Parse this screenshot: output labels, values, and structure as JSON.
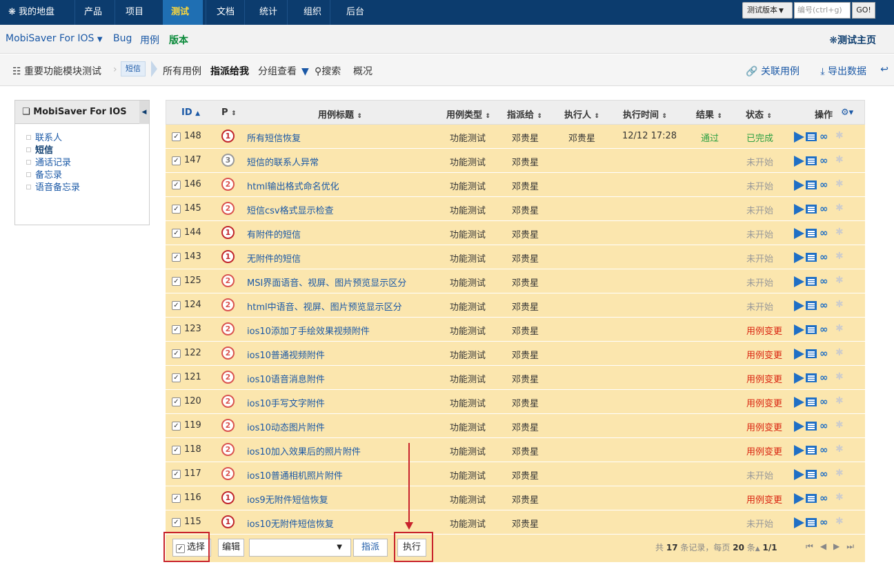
{
  "topnav": {
    "items": [
      "我的地盘",
      "产品",
      "项目",
      "测试",
      "文档",
      "统计",
      "组织",
      "后台"
    ],
    "home_icon": "home-icon",
    "version_button": "测试版本",
    "id_input_placeholder": "编号(ctrl+g)",
    "go_button": "GO!"
  },
  "subnav": {
    "product": "MobiSaver For IOS",
    "bug": "Bug",
    "case": "用例",
    "version": "版本",
    "home": "测试主页"
  },
  "featurebar": {
    "breadcrumb": "重要功能模块测试",
    "current_module": "短信",
    "tabs": [
      "所有用例",
      "指派给我",
      "分组查看",
      "搜索",
      "概况"
    ],
    "link_cases": "关联用例",
    "export_data": "导出数据"
  },
  "sidebar": {
    "title": "MobiSaver For IOS",
    "items": [
      "联系人",
      "短信",
      "通话记录",
      "备忘录",
      "语音备忘录"
    ],
    "active": "短信"
  },
  "table": {
    "headers": [
      "ID",
      "P",
      "用例标题",
      "用例类型",
      "指派给",
      "执行人",
      "执行时间",
      "结果",
      "状态",
      "操作"
    ],
    "rows": [
      {
        "id": "148",
        "p": "1",
        "title": "所有短信恢复",
        "type": "功能测试",
        "assign": "邓贵星",
        "executor": "邓贵星",
        "time": "12/12 17:28",
        "result": "通过",
        "status": "已完成",
        "status_color": "green"
      },
      {
        "id": "147",
        "p": "3",
        "title": "短信的联系人异常",
        "type": "功能测试",
        "assign": "邓贵星",
        "executor": "",
        "time": "",
        "result": "",
        "status": "未开始",
        "status_color": "gray"
      },
      {
        "id": "146",
        "p": "2",
        "title": "html输出格式命名优化",
        "type": "功能测试",
        "assign": "邓贵星",
        "executor": "",
        "time": "",
        "result": "",
        "status": "未开始",
        "status_color": "gray"
      },
      {
        "id": "145",
        "p": "2",
        "title": "短信csv格式显示检查",
        "type": "功能测试",
        "assign": "邓贵星",
        "executor": "",
        "time": "",
        "result": "",
        "status": "未开始",
        "status_color": "gray"
      },
      {
        "id": "144",
        "p": "1",
        "title": "有附件的短信",
        "type": "功能测试",
        "assign": "邓贵星",
        "executor": "",
        "time": "",
        "result": "",
        "status": "未开始",
        "status_color": "gray"
      },
      {
        "id": "143",
        "p": "1",
        "title": "无附件的短信",
        "type": "功能测试",
        "assign": "邓贵星",
        "executor": "",
        "time": "",
        "result": "",
        "status": "未开始",
        "status_color": "gray"
      },
      {
        "id": "125",
        "p": "2",
        "title": "MSI界面语音、视屏、图片预览显示区分",
        "type": "功能测试",
        "assign": "邓贵星",
        "executor": "",
        "time": "",
        "result": "",
        "status": "未开始",
        "status_color": "gray"
      },
      {
        "id": "124",
        "p": "2",
        "title": "html中语音、视屏、图片预览显示区分",
        "type": "功能测试",
        "assign": "邓贵星",
        "executor": "",
        "time": "",
        "result": "",
        "status": "未开始",
        "status_color": "gray"
      },
      {
        "id": "123",
        "p": "2",
        "title": "ios10添加了手绘效果视频附件",
        "type": "功能测试",
        "assign": "邓贵星",
        "executor": "",
        "time": "",
        "result": "",
        "status": "用例变更",
        "status_color": "red"
      },
      {
        "id": "122",
        "p": "2",
        "title": "ios10普通视频附件",
        "type": "功能测试",
        "assign": "邓贵星",
        "executor": "",
        "time": "",
        "result": "",
        "status": "用例变更",
        "status_color": "red"
      },
      {
        "id": "121",
        "p": "2",
        "title": "ios10语音消息附件",
        "type": "功能测试",
        "assign": "邓贵星",
        "executor": "",
        "time": "",
        "result": "",
        "status": "用例变更",
        "status_color": "red"
      },
      {
        "id": "120",
        "p": "2",
        "title": "ios10手写文字附件",
        "type": "功能测试",
        "assign": "邓贵星",
        "executor": "",
        "time": "",
        "result": "",
        "status": "用例变更",
        "status_color": "red"
      },
      {
        "id": "119",
        "p": "2",
        "title": "ios10动态图片附件",
        "type": "功能测试",
        "assign": "邓贵星",
        "executor": "",
        "time": "",
        "result": "",
        "status": "用例变更",
        "status_color": "red"
      },
      {
        "id": "118",
        "p": "2",
        "title": "ios10加入效果后的照片附件",
        "type": "功能测试",
        "assign": "邓贵星",
        "executor": "",
        "time": "",
        "result": "",
        "status": "用例变更",
        "status_color": "red"
      },
      {
        "id": "117",
        "p": "2",
        "title": "ios10普通相机照片附件",
        "type": "功能测试",
        "assign": "邓贵星",
        "executor": "",
        "time": "",
        "result": "",
        "status": "未开始",
        "status_color": "gray"
      },
      {
        "id": "116",
        "p": "1",
        "title": "ios9无附件短信恢复",
        "type": "功能测试",
        "assign": "邓贵星",
        "executor": "",
        "time": "",
        "result": "",
        "status": "用例变更",
        "status_color": "red"
      },
      {
        "id": "115",
        "p": "1",
        "title": "ios10无附件短信恢复",
        "type": "功能测试",
        "assign": "邓贵星",
        "executor": "",
        "time": "",
        "result": "",
        "status": "未开始",
        "status_color": "gray"
      }
    ]
  },
  "footer": {
    "select_all": "选择",
    "edit": "编辑",
    "assign": "指派",
    "run": "执行",
    "pager_prefix": "共",
    "total": "17",
    "pager_mid": "条记录，每页",
    "per_page": "20",
    "pager_suffix": "条",
    "page": "1/1"
  },
  "colors": {
    "nav_bg": "#0c3c6e",
    "active_tab": "#1f6fb3",
    "row_bg": "#fbe6ae",
    "link": "#1a58a6",
    "highlight": "#c8232c"
  }
}
